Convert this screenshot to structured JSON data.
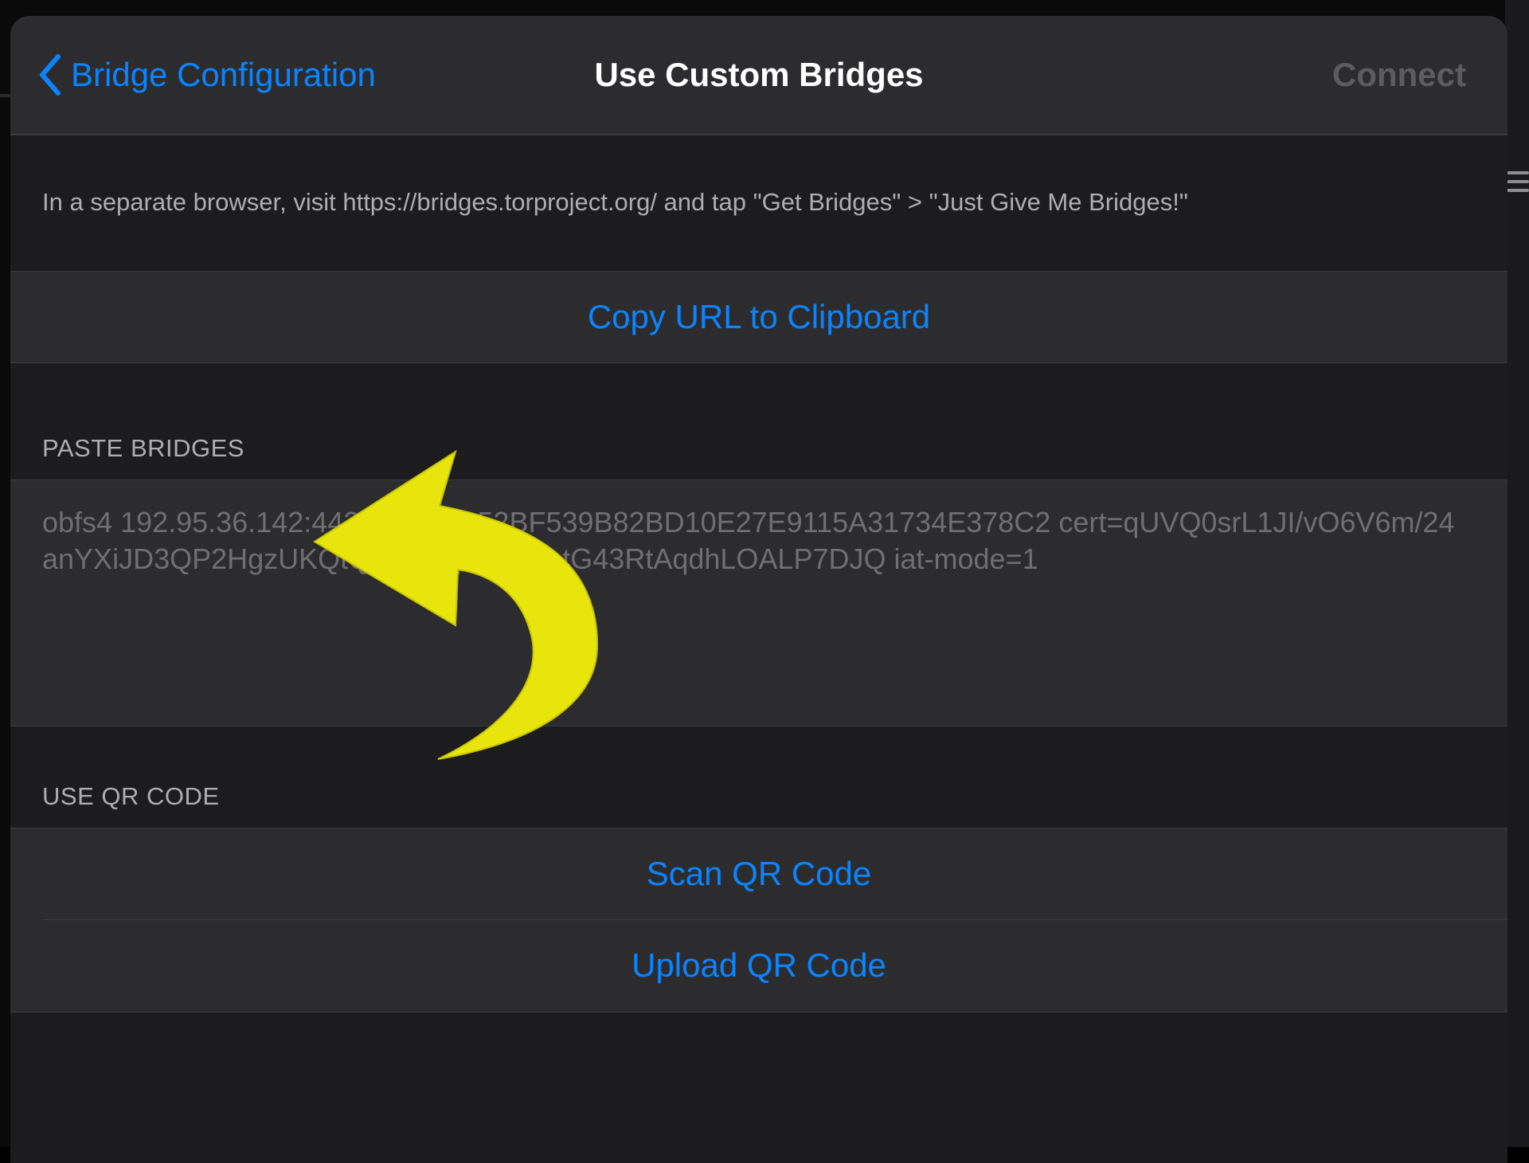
{
  "navbar": {
    "back_label": "Bridge Configuration",
    "title": "Use Custom Bridges",
    "connect_label": "Connect"
  },
  "instructions": "In a separate browser, visit https://bridges.torproject.org/ and tap \"Get Bridges\" > \"Just Give Me Bridges!\"",
  "copy_url_label": "Copy URL to Clipboard",
  "paste_section": {
    "header": "PASTE BRIDGES",
    "bridges_value": "obfs4 192.95.36.142:443 CDF2E852BF539B82BD10E27E9115A31734E378C2 cert=qUVQ0srL1JI/vO6V6m/24anYXiJD3QP2HgzUKQtQ7GRqqUvs7P+tG43RtAqdhLOALP7DJQ iat-mode=1"
  },
  "qr_section": {
    "header": "USE QR CODE",
    "scan_label": "Scan QR Code",
    "upload_label": "Upload QR Code"
  },
  "colors": {
    "accent": "#0a84ff",
    "annotation_arrow": "#e8e50c"
  },
  "icons": {
    "back": "chevron-left-icon",
    "annotation": "curved-arrow-icon",
    "menu": "hamburger-menu-icon"
  }
}
